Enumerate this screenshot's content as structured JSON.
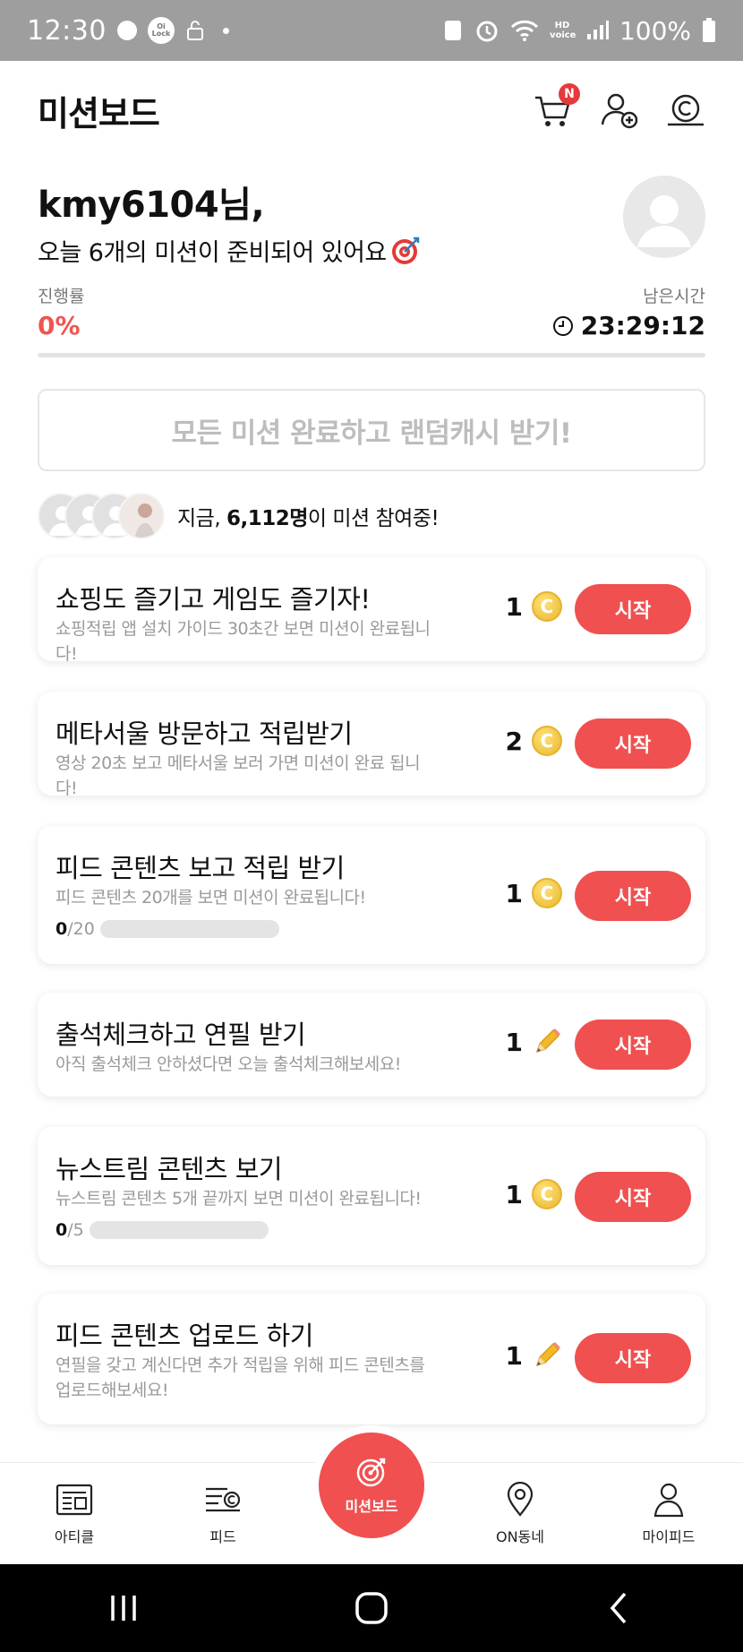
{
  "status_bar": {
    "time": "12:30",
    "lock_badge": "Oi Lock",
    "hd_voice": "HD voice",
    "battery": "100%"
  },
  "header": {
    "title": "미션보드",
    "cart_badge": "N"
  },
  "greeting": {
    "name": "kmy6104님,",
    "subtitle": "오늘 6개의 미션이 준비되어 있어요"
  },
  "progress": {
    "label": "진행률",
    "value": "0%",
    "fraction": 0,
    "remaining_label": "남은시간",
    "remaining_value": "23:29:12"
  },
  "complete_banner": "모든 미션 완료하고 랜덤캐시 받기!",
  "participants": {
    "prefix": "지금, ",
    "count": "6,112명",
    "suffix": "이 미션 참여중!"
  },
  "missions": [
    {
      "title": "쇼핑도 즐기고 게임도 즐기자!",
      "desc": "쇼핑적립 앱 설치 가이드 30초간 보면 미션이 완료됩니다!",
      "reward": "1",
      "reward_icon": "coin-icon",
      "button": "시작"
    },
    {
      "title": "메타서울 방문하고 적립받기",
      "desc": "영상 20초 보고 메타서울 보러 가면 미션이 완료 됩니다!",
      "reward": "2",
      "reward_icon": "coin-icon",
      "button": "시작"
    },
    {
      "title": "피드 콘텐츠 보고 적립 받기",
      "desc": "피드 콘텐츠 20개를 보면 미션이 완료됩니다!",
      "progress_done": "0",
      "progress_total": "/20",
      "reward": "1",
      "reward_icon": "coin-icon",
      "button": "시작"
    },
    {
      "title": "출석체크하고 연필 받기",
      "desc": "아직 출석체크 안하셨다면 오늘 출석체크해보세요!",
      "reward": "1",
      "reward_icon": "pencil-icon",
      "button": "시작"
    },
    {
      "title": "뉴스트림 콘텐츠 보기",
      "desc": "뉴스트림 콘텐츠 5개 끝까지 보면 미션이 완료됩니다!",
      "progress_done": "0",
      "progress_total": "/5",
      "reward": "1",
      "reward_icon": "coin-icon",
      "button": "시작"
    },
    {
      "title": "피드 콘텐츠 업로드 하기",
      "desc": "연필을 갖고 계신다면 추가 적립을 위해 피드 콘텐츠를 업로드해보세요!",
      "reward": "1",
      "reward_icon": "pencil-icon",
      "button": "시작"
    }
  ],
  "bottom_nav": {
    "article": "아티클",
    "feed": "피드",
    "missionboard": "미션보드",
    "on_dongne": "ON동네",
    "my_feed": "마이피드"
  },
  "colors": {
    "accent": "#f05050",
    "progress_text": "#ee5550",
    "coin": "#e9b72c"
  }
}
